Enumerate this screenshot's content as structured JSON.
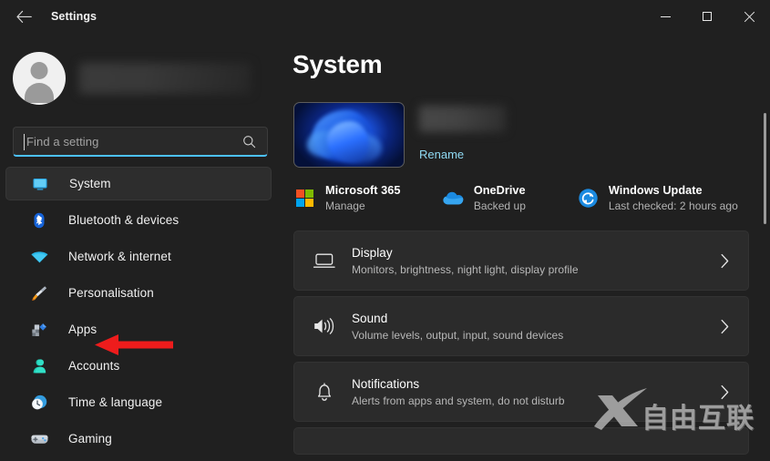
{
  "window": {
    "title": "Settings",
    "back_icon": "back-arrow-icon",
    "controls": {
      "minimize": "minimize-icon",
      "maximize": "maximize-icon",
      "close": "close-icon"
    }
  },
  "account": {
    "avatar_icon": "user-avatar-icon",
    "username": ""
  },
  "search": {
    "placeholder": "Find a setting",
    "value": "",
    "icon": "search-icon",
    "focused": true,
    "accent": "#4cc2ff"
  },
  "sidebar": {
    "items": [
      {
        "label": "System",
        "icon": "monitor-icon",
        "active": true
      },
      {
        "label": "Bluetooth & devices",
        "icon": "bluetooth-icon",
        "active": false
      },
      {
        "label": "Network & internet",
        "icon": "wifi-icon",
        "active": false
      },
      {
        "label": "Personalisation",
        "icon": "paintbrush-icon",
        "active": false
      },
      {
        "label": "Apps",
        "icon": "apps-icon",
        "active": false
      },
      {
        "label": "Accounts",
        "icon": "person-icon",
        "active": false
      },
      {
        "label": "Time & language",
        "icon": "clock-icon",
        "active": false
      },
      {
        "label": "Gaming",
        "icon": "gamepad-icon",
        "active": false
      }
    ]
  },
  "main": {
    "page_title": "System",
    "device": {
      "thumbnail": "windows-bloom-wallpaper",
      "name": "",
      "rename_label": "Rename",
      "rename_color": "#8fd9f2"
    },
    "quick_links": [
      {
        "title": "Microsoft 365",
        "subtitle": "Manage",
        "icon": "microsoft-logo-icon"
      },
      {
        "title": "OneDrive",
        "subtitle": "Backed up",
        "icon": "onedrive-cloud-icon"
      },
      {
        "title": "Windows Update",
        "subtitle": "Last checked: 2 hours ago",
        "icon": "windows-update-icon"
      }
    ],
    "cards": [
      {
        "title": "Display",
        "subtitle": "Monitors, brightness, night light, display profile",
        "icon": "display-monitor-icon",
        "chevron": "chevron-right-icon"
      },
      {
        "title": "Sound",
        "subtitle": "Volume levels, output, input, sound devices",
        "icon": "speaker-icon",
        "chevron": "chevron-right-icon"
      },
      {
        "title": "Notifications",
        "subtitle": "Alerts from apps and system, do not disturb",
        "icon": "bell-icon",
        "chevron": "chevron-right-icon"
      }
    ]
  },
  "annotation": {
    "arrow_color": "#ee1c1c",
    "points_to": "Apps"
  },
  "watermark": {
    "text": "自由互联",
    "logo": "x-logo-icon"
  },
  "theme": {
    "window_bg": "#202020",
    "card_bg": "#2b2b2b",
    "accent": "#4cc2ff",
    "text_primary": "#ffffff",
    "text_secondary": "#b3b3b3"
  },
  "scrollbar": {
    "thumb_position_pct": 0
  }
}
